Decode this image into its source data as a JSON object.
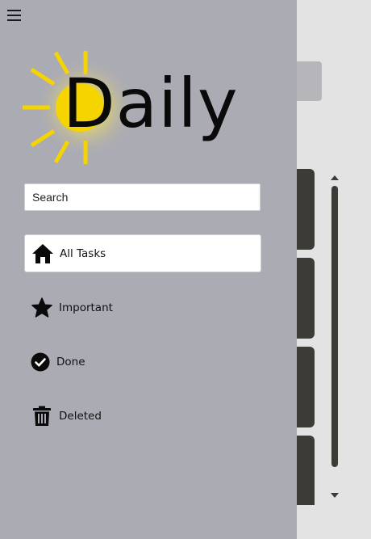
{
  "app": {
    "logo_text": "Daily"
  },
  "search": {
    "placeholder": "Search"
  },
  "nav": {
    "items": [
      {
        "label": "All Tasks",
        "icon": "home-icon",
        "active": true
      },
      {
        "label": "Important",
        "icon": "star-icon",
        "active": false
      },
      {
        "label": "Done",
        "icon": "check-circle-icon",
        "active": false
      },
      {
        "label": "Deleted",
        "icon": "trash-icon",
        "active": false
      }
    ]
  },
  "colors": {
    "drawer_bg": "#ababb4",
    "page_bg": "#e3e3e3",
    "card_bg": "#3c3b36",
    "sun": "#f5d400"
  }
}
